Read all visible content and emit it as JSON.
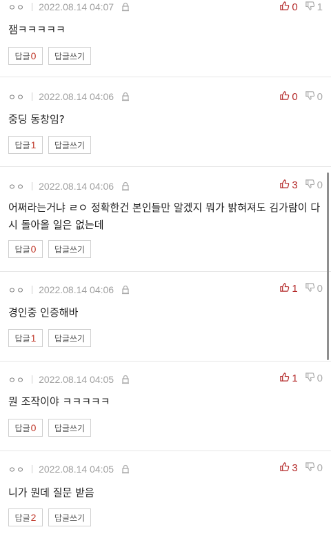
{
  "comments": [
    {
      "nickname": "ㅇㅇ",
      "date": "2022.08.14 04:07",
      "upvotes": "0",
      "downvotes": "1",
      "text": "잼ㅋㅋㅋㅋㅋ",
      "reply_label": "답글",
      "reply_count": "0",
      "write_label": "답글쓰기"
    },
    {
      "nickname": "ㅇㅇ",
      "date": "2022.08.14 04:06",
      "upvotes": "0",
      "downvotes": "0",
      "text": "중딩 동창임?",
      "reply_label": "답글",
      "reply_count": "1",
      "write_label": "답글쓰기"
    },
    {
      "nickname": "ㅇㅇ",
      "date": "2022.08.14 04:06",
      "upvotes": "3",
      "downvotes": "0",
      "text": "어쩌라는거냐 ㄹㅇ 정확한건 본인들만 알겠지 뭐가 밝혀져도 김가람이 다시 돌아올 일은 없는데",
      "reply_label": "답글",
      "reply_count": "0",
      "write_label": "답글쓰기"
    },
    {
      "nickname": "ㅇㅇ",
      "date": "2022.08.14 04:06",
      "upvotes": "1",
      "downvotes": "0",
      "text": "경인중 인증해바",
      "reply_label": "답글",
      "reply_count": "1",
      "write_label": "답글쓰기"
    },
    {
      "nickname": "ㅇㅇ",
      "date": "2022.08.14 04:05",
      "upvotes": "1",
      "downvotes": "0",
      "text": "뭔 조작이야 ㅋㅋㅋㅋㅋ",
      "reply_label": "답글",
      "reply_count": "0",
      "write_label": "답글쓰기"
    },
    {
      "nickname": "ㅇㅇ",
      "date": "2022.08.14 04:05",
      "upvotes": "3",
      "downvotes": "0",
      "text": "니가 뭔데 질문 받음",
      "reply_label": "답글",
      "reply_count": "2",
      "write_label": "답글쓰기"
    }
  ],
  "icons": {
    "lock": "lock-icon",
    "upvote": "thumbs-up-icon",
    "downvote": "thumbs-down-icon"
  },
  "colors": {
    "upvote": "#b42a2a",
    "reply_count": "#c0392b",
    "muted": "#a0a0a0"
  }
}
